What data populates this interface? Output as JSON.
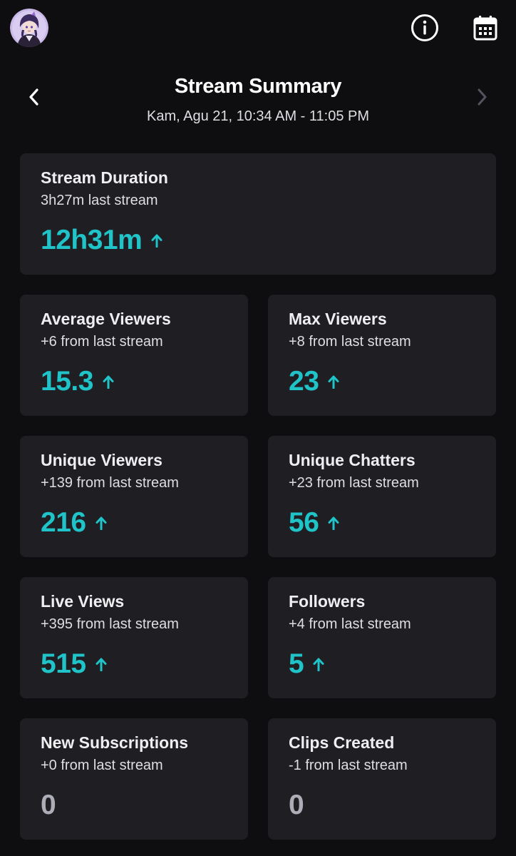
{
  "topbar": {
    "avatar": "avatar",
    "info_icon": "info-icon",
    "calendar_icon": "calendar-icon"
  },
  "header": {
    "title": "Stream Summary",
    "subtitle": "Kam, Agu 21, 10:34 AM - 11:05 PM",
    "prev_icon": "chevron-left-icon",
    "next_icon": "chevron-right-icon"
  },
  "colors": {
    "background": "#0e0e10",
    "card": "#1f1f23",
    "accent_up": "#1fc3c8",
    "neutral_value": "#adadb8"
  },
  "stats": {
    "duration": {
      "title": "Stream Duration",
      "sub": "3h27m last stream",
      "value": "12h31m",
      "trend": "up"
    },
    "avg_viewers": {
      "title": "Average Viewers",
      "sub": "+6 from last stream",
      "value": "15.3",
      "trend": "up"
    },
    "max_viewers": {
      "title": "Max Viewers",
      "sub": "+8 from last stream",
      "value": "23",
      "trend": "up"
    },
    "unique_viewers": {
      "title": "Unique Viewers",
      "sub": "+139 from last stream",
      "value": "216",
      "trend": "up"
    },
    "unique_chatters": {
      "title": "Unique Chatters",
      "sub": "+23 from last stream",
      "value": "56",
      "trend": "up"
    },
    "live_views": {
      "title": "Live Views",
      "sub": "+395 from last stream",
      "value": "515",
      "trend": "up"
    },
    "followers": {
      "title": "Followers",
      "sub": "+4 from last stream",
      "value": "5",
      "trend": "up"
    },
    "new_subs": {
      "title": "New Subscriptions",
      "sub": "+0 from last stream",
      "value": "0",
      "trend": "none"
    },
    "clips": {
      "title": "Clips Created",
      "sub": "-1 from last stream",
      "value": "0",
      "trend": "none"
    }
  }
}
